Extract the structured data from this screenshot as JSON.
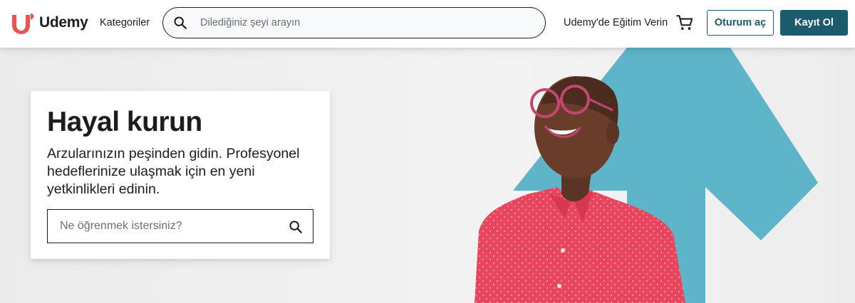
{
  "header": {
    "logo_text": "Udemy",
    "categories_label": "Kategoriler",
    "search_placeholder": "Dilediğiniz şeyi arayın",
    "teach_label": "Udemy'de Eğitim Verin",
    "login_label": "Oturum aç",
    "signup_label": "Kayıt Ol",
    "icons": {
      "search": "search-icon",
      "cart": "cart-icon",
      "logo": "udemy-logo-icon"
    }
  },
  "hero": {
    "title": "Hayal kurun",
    "subtitle": "Arzularınızın peşinden gidin. Profesyonel hedeflerinize ulaşmak için en yeni yetkinlikleri edinin.",
    "search_placeholder": "Ne öğrenmek istersiniz?",
    "image": "smiling-woman-red-shirt-with-teal-arrow"
  },
  "colors": {
    "brand": "#a435f0",
    "logo_red": "#ec5252",
    "button_teal": "#1c5a6e",
    "arrow_teal": "#5eb4c8",
    "shirt_red": "#e8465e"
  }
}
